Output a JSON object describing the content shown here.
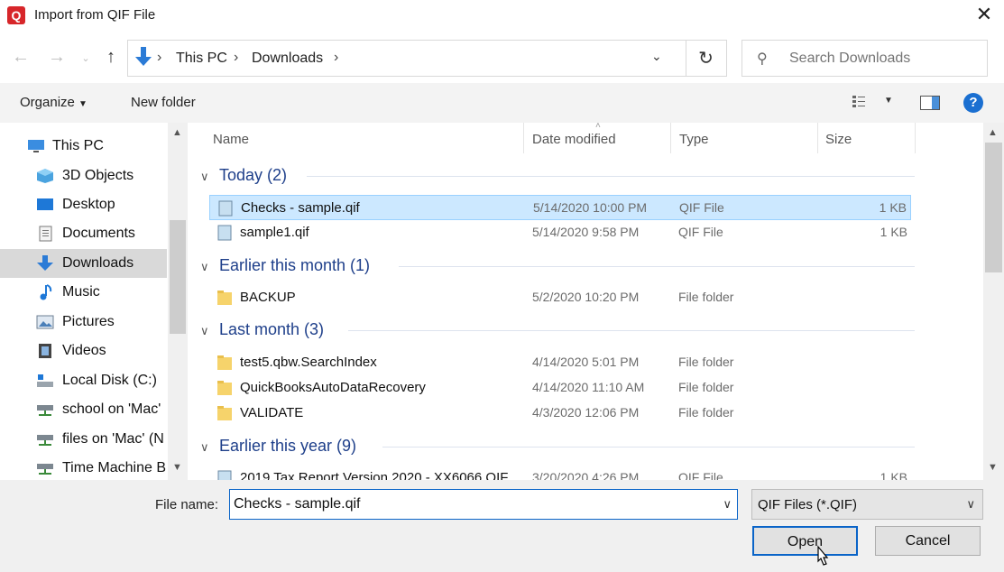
{
  "window": {
    "title": "Import from QIF File",
    "app_icon_letter": "Q"
  },
  "address": {
    "crumbs": [
      "This PC",
      "Downloads"
    ]
  },
  "search": {
    "placeholder": "Search Downloads"
  },
  "toolbar": {
    "organize": "Organize",
    "new_folder": "New folder",
    "help": "?"
  },
  "sidebar": {
    "items": [
      {
        "label": "This PC",
        "icon": "pc-icon"
      },
      {
        "label": "3D Objects",
        "icon": "cube-icon"
      },
      {
        "label": "Desktop",
        "icon": "desktop-icon"
      },
      {
        "label": "Documents",
        "icon": "documents-icon"
      },
      {
        "label": "Downloads",
        "icon": "download-icon"
      },
      {
        "label": "Music",
        "icon": "music-icon"
      },
      {
        "label": "Pictures",
        "icon": "pictures-icon"
      },
      {
        "label": "Videos",
        "icon": "videos-icon"
      },
      {
        "label": "Local Disk (C:)",
        "icon": "disk-icon"
      },
      {
        "label": "school on 'Mac'",
        "icon": "network-drive-icon"
      },
      {
        "label": "files on 'Mac' (N",
        "icon": "network-drive-icon"
      },
      {
        "label": "Time Machine B",
        "icon": "network-drive-icon"
      }
    ]
  },
  "columns": {
    "name": "Name",
    "date": "Date modified",
    "type": "Type",
    "size": "Size"
  },
  "groups": [
    {
      "title": "Today (2)"
    },
    {
      "title": "Earlier this month (1)"
    },
    {
      "title": "Last month (3)"
    },
    {
      "title": "Earlier this year (9)"
    }
  ],
  "files": [
    {
      "name": "Checks - sample.qif",
      "date": "5/14/2020 10:00 PM",
      "type": "QIF File",
      "size": "1 KB"
    },
    {
      "name": "sample1.qif",
      "date": "5/14/2020 9:58 PM",
      "type": "QIF File",
      "size": "1 KB"
    },
    {
      "name": "BACKUP",
      "date": "5/2/2020 10:20 PM",
      "type": "File folder",
      "size": ""
    },
    {
      "name": "test5.qbw.SearchIndex",
      "date": "4/14/2020 5:01 PM",
      "type": "File folder",
      "size": ""
    },
    {
      "name": "QuickBooksAutoDataRecovery",
      "date": "4/14/2020 11:10 AM",
      "type": "File folder",
      "size": ""
    },
    {
      "name": "VALIDATE",
      "date": "4/3/2020 12:06 PM",
      "type": "File folder",
      "size": ""
    },
    {
      "name": "2019 Tax Report Version 2020 - XX6066.QIF",
      "date": "3/20/2020 4:26 PM",
      "type": "QIF File",
      "size": "1 KB"
    }
  ],
  "footer": {
    "file_name_label": "File name:",
    "file_name_value": "Checks - sample.qif",
    "file_type": "QIF Files (*.QIF)",
    "open": "Open",
    "cancel": "Cancel"
  },
  "colors": {
    "accent": "#0a64c8",
    "group_header": "#1e3f8a",
    "selection": "#cce8ff",
    "app_icon": "#d7262a"
  }
}
